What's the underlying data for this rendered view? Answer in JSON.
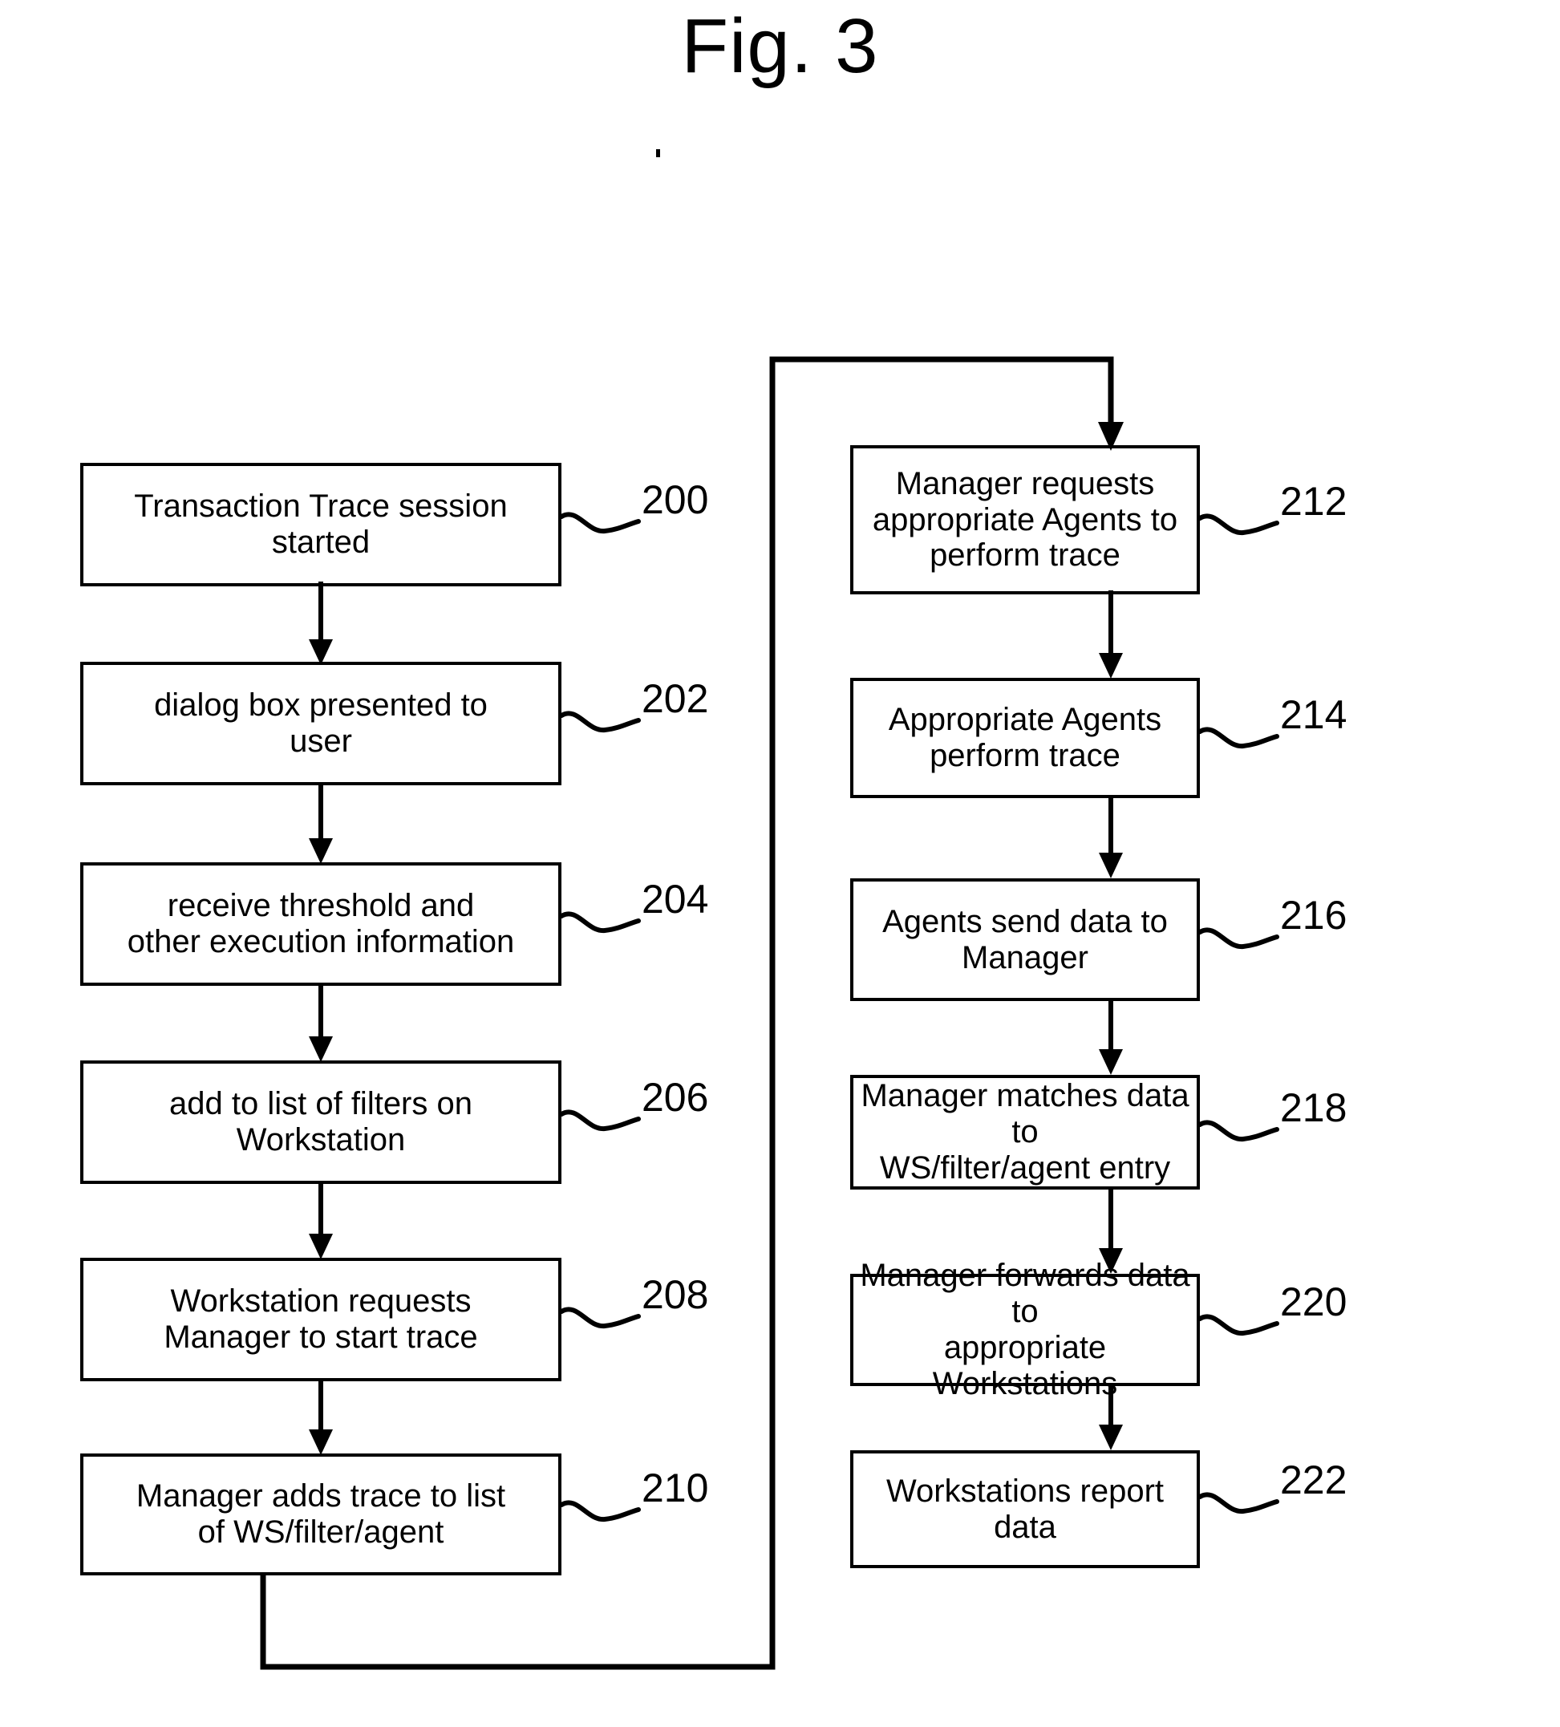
{
  "figure": {
    "title": "Fig. 3",
    "type": "flowchart",
    "orientation": "two-column",
    "stroke_color": "#000000",
    "background_color": "#ffffff"
  },
  "columns": {
    "left": {
      "name": "left-column",
      "nodes": [
        {
          "ref": "200",
          "text": "Transaction Trace session\nstarted"
        },
        {
          "ref": "202",
          "text": "dialog box presented to\nuser"
        },
        {
          "ref": "204",
          "text": "receive threshold and\nother execution information"
        },
        {
          "ref": "206",
          "text": "add to list of filters on\nWorkstation"
        },
        {
          "ref": "208",
          "text": "Workstation requests\nManager to start trace"
        },
        {
          "ref": "210",
          "text": "Manager adds trace to list\nof WS/filter/agent"
        }
      ]
    },
    "right": {
      "name": "right-column",
      "nodes": [
        {
          "ref": "212",
          "text": "Manager requests\nappropriate Agents to\nperform trace"
        },
        {
          "ref": "214",
          "text": "Appropriate Agents\nperform trace"
        },
        {
          "ref": "216",
          "text": "Agents send data to\nManager"
        },
        {
          "ref": "218",
          "text": "Manager matches data to\nWS/filter/agent entry"
        },
        {
          "ref": "220",
          "text": "Manager forwards data to\nappropriate Workstations"
        },
        {
          "ref": "222",
          "text": "Workstations report data"
        }
      ]
    }
  },
  "flow": {
    "sequence": [
      "200",
      "202",
      "204",
      "206",
      "208",
      "210",
      "212",
      "214",
      "216",
      "218",
      "220",
      "222"
    ],
    "connector_note": "210 connects to 212 via a routed loop line running below the left column, up the middle channel, and across the top into 212"
  }
}
